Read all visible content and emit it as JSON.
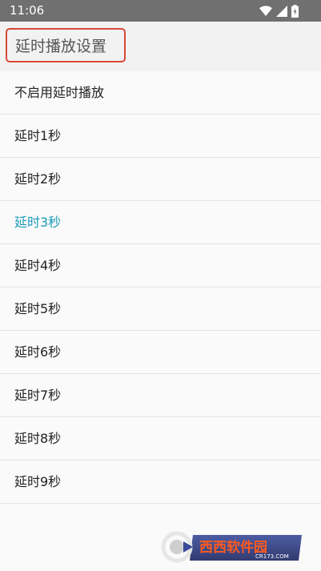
{
  "status_bar": {
    "time": "11:06",
    "icons": [
      "wifi-icon",
      "signal-icon",
      "battery-icon"
    ]
  },
  "title": {
    "text": "延时播放设置"
  },
  "options": [
    {
      "label": "不启用延时播放",
      "selected": false
    },
    {
      "label": "延时1秒",
      "selected": false
    },
    {
      "label": "延时2秒",
      "selected": false
    },
    {
      "label": "延时3秒",
      "selected": true
    },
    {
      "label": "延时4秒",
      "selected": false
    },
    {
      "label": "延时5秒",
      "selected": false
    },
    {
      "label": "延时6秒",
      "selected": false
    },
    {
      "label": "延时7秒",
      "selected": false
    },
    {
      "label": "延时8秒",
      "selected": false
    },
    {
      "label": "延时9秒",
      "selected": false
    }
  ],
  "watermark": {
    "brand": "西西软件园",
    "site": "CR173.COM"
  },
  "colors": {
    "status_bar_bg": "#707070",
    "title_bar_bg": "#f2f2f2",
    "title_box_border": "#d9473a",
    "selected_text": "#1a9bb8",
    "normal_text": "#222222"
  }
}
